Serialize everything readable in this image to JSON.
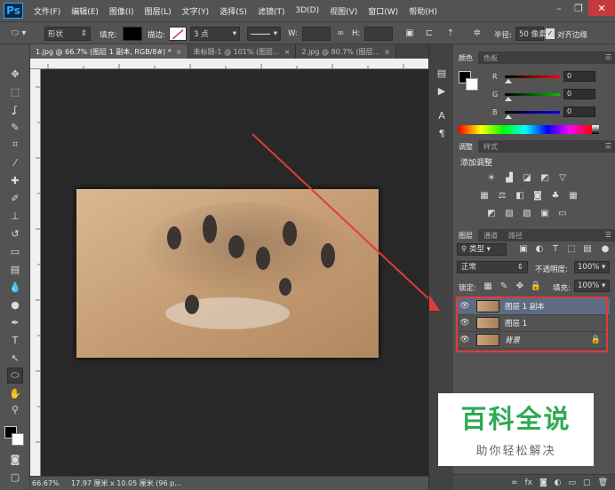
{
  "app": {
    "logo": "Ps"
  },
  "menu": [
    "文件(F)",
    "编辑(E)",
    "图像(I)",
    "图层(L)",
    "文字(Y)",
    "选择(S)",
    "滤镜(T)",
    "3D(D)",
    "视图(V)",
    "窗口(W)",
    "帮助(H)"
  ],
  "window_buttons": {
    "minimize": "–",
    "restore": "❐",
    "close": "✕"
  },
  "options": {
    "mode": "形状",
    "fill_label": "填充:",
    "stroke_label": "描边:",
    "stroke_width": "3 点",
    "w_label": "W:",
    "h_label": "H:",
    "radius_label": "半径:",
    "radius_value": "50 像素",
    "align_edges": "对齐边缘",
    "accent_fill": "#000000",
    "accent_stroke": "#d23b3b"
  },
  "tabs": [
    {
      "label": "1.jpg @ 66.7% (图层 1 副本, RGB/8#) *",
      "close": "×"
    },
    {
      "label": "未标题-1 @ 101% (图层...",
      "close": "×"
    },
    {
      "label": "2.jpg @ 80.7% (图层...",
      "close": "×"
    }
  ],
  "status": {
    "zoom": "66.67%",
    "doc_info": "17.97 厘米 x 10.05 厘米 (96 p..."
  },
  "color_panel": {
    "tabs": [
      "颜色",
      "色板"
    ],
    "channels": [
      {
        "name": "R",
        "value": "0",
        "color": "#ff0000"
      },
      {
        "name": "G",
        "value": "0",
        "color": "#00c000"
      },
      {
        "name": "B",
        "value": "0",
        "color": "#0000ff"
      }
    ]
  },
  "adjust_panel": {
    "tabs": [
      "调整",
      "样式"
    ],
    "title": "添加调整"
  },
  "layers_panel": {
    "tabs": [
      "图层",
      "通道",
      "路径"
    ],
    "filter": "类型",
    "blend_mode": "正常",
    "opacity_label": "不透明度:",
    "opacity_value": "100%",
    "lock_label": "锁定:",
    "fill_label": "填充:",
    "fill_value": "100%",
    "layers": [
      {
        "name": "图层 1 副本",
        "selected": true
      },
      {
        "name": "图层 1",
        "selected": false
      },
      {
        "name": "背景",
        "selected": false,
        "locked": true
      }
    ],
    "footer_icons": [
      "link-icon",
      "fx-icon",
      "mask-icon",
      "adjustment-icon",
      "folder-icon",
      "new-layer-icon",
      "trash-icon"
    ]
  },
  "watermark": {
    "title": "百科全说",
    "subtitle": "助你轻松解决",
    "color": "#2eaa52"
  }
}
